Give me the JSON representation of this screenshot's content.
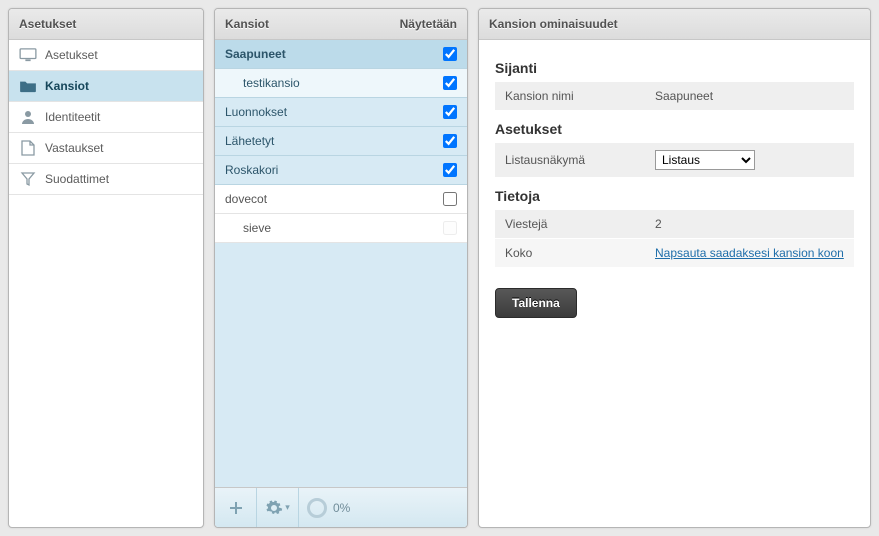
{
  "sidebar": {
    "title": "Asetukset",
    "items": [
      {
        "label": "Asetukset",
        "icon": "monitor-icon",
        "selected": false
      },
      {
        "label": "Kansiot",
        "icon": "folder-icon",
        "selected": true
      },
      {
        "label": "Identiteetit",
        "icon": "person-icon",
        "selected": false
      },
      {
        "label": "Vastaukset",
        "icon": "document-icon",
        "selected": false
      },
      {
        "label": "Suodattimet",
        "icon": "filter-icon",
        "selected": false
      }
    ]
  },
  "folders": {
    "title": "Kansiot",
    "col_right": "Näytetään",
    "rows": [
      {
        "label": "Saapuneet",
        "checked": true,
        "selected": true,
        "child": false,
        "plain": false,
        "disabled": false
      },
      {
        "label": "testikansio",
        "checked": true,
        "selected": false,
        "child": true,
        "plain": false,
        "disabled": false
      },
      {
        "label": "Luonnokset",
        "checked": true,
        "selected": false,
        "child": false,
        "plain": false,
        "disabled": false
      },
      {
        "label": "Lähetetyt",
        "checked": true,
        "selected": false,
        "child": false,
        "plain": false,
        "disabled": false
      },
      {
        "label": "Roskakori",
        "checked": true,
        "selected": false,
        "child": false,
        "plain": false,
        "disabled": false
      },
      {
        "label": "dovecot",
        "checked": false,
        "selected": false,
        "child": false,
        "plain": true,
        "disabled": false
      },
      {
        "label": "sieve",
        "checked": false,
        "selected": false,
        "child": true,
        "plain": true,
        "disabled": true
      }
    ],
    "toolbar": {
      "add": "+",
      "settings": "gear-icon",
      "quota_pct": "0%"
    }
  },
  "props": {
    "header": "Kansion ominaisuudet",
    "location_heading": "Sijanti",
    "name_label": "Kansion nimi",
    "name_value": "Saapuneet",
    "settings_heading": "Asetukset",
    "listview_label": "Listausnäkymä",
    "listview_value": "Listaus",
    "listview_options": [
      "Listaus"
    ],
    "info_heading": "Tietoja",
    "messages_label": "Viestejä",
    "messages_value": "2",
    "size_label": "Koko",
    "size_link": "Napsauta saadaksesi kansion koon",
    "save_label": "Tallenna"
  }
}
